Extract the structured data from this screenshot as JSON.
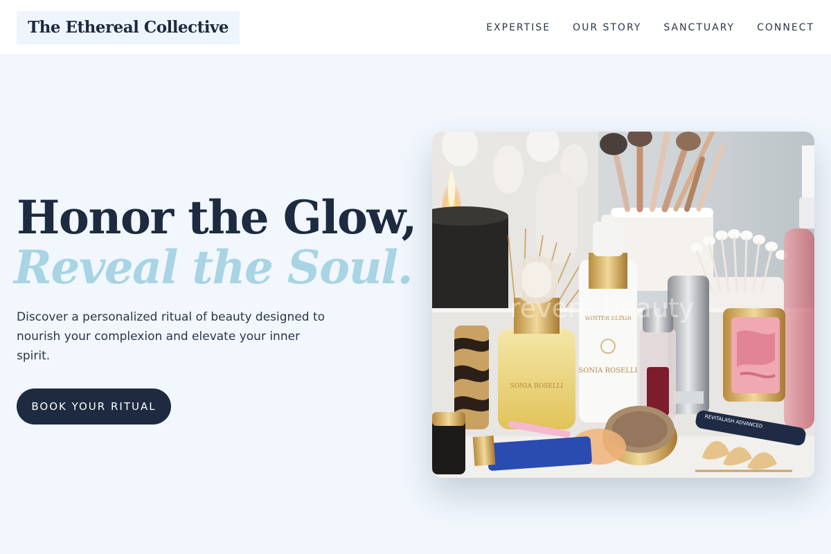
{
  "brand": {
    "name": "The Ethereal Collective"
  },
  "nav": {
    "items": [
      {
        "label": "EXPERTISE"
      },
      {
        "label": "OUR STORY"
      },
      {
        "label": "SANCTUARY"
      },
      {
        "label": "CONNECT"
      }
    ]
  },
  "hero": {
    "headline_line1": "Honor the Glow,",
    "headline_line2": "Reveal the Soul.",
    "description": "Discover a personalized ritual of beauty designed to nourish your complexion and elevate your inner spirit.",
    "cta_label": "BOOK YOUR RITUAL"
  },
  "image": {
    "watermark": "revere beauty",
    "product_labels": {
      "serum_brand": "SONIA ROSELLI",
      "bottle_brand": "SONIA ROSELLI",
      "bottle_product": "WINTER ELIXIR",
      "mascara": "REVITALASH ADVANCED"
    }
  },
  "colors": {
    "primary": "#1d2a3f",
    "accent": "#a8d4e4",
    "background": "#f1f7fd"
  }
}
